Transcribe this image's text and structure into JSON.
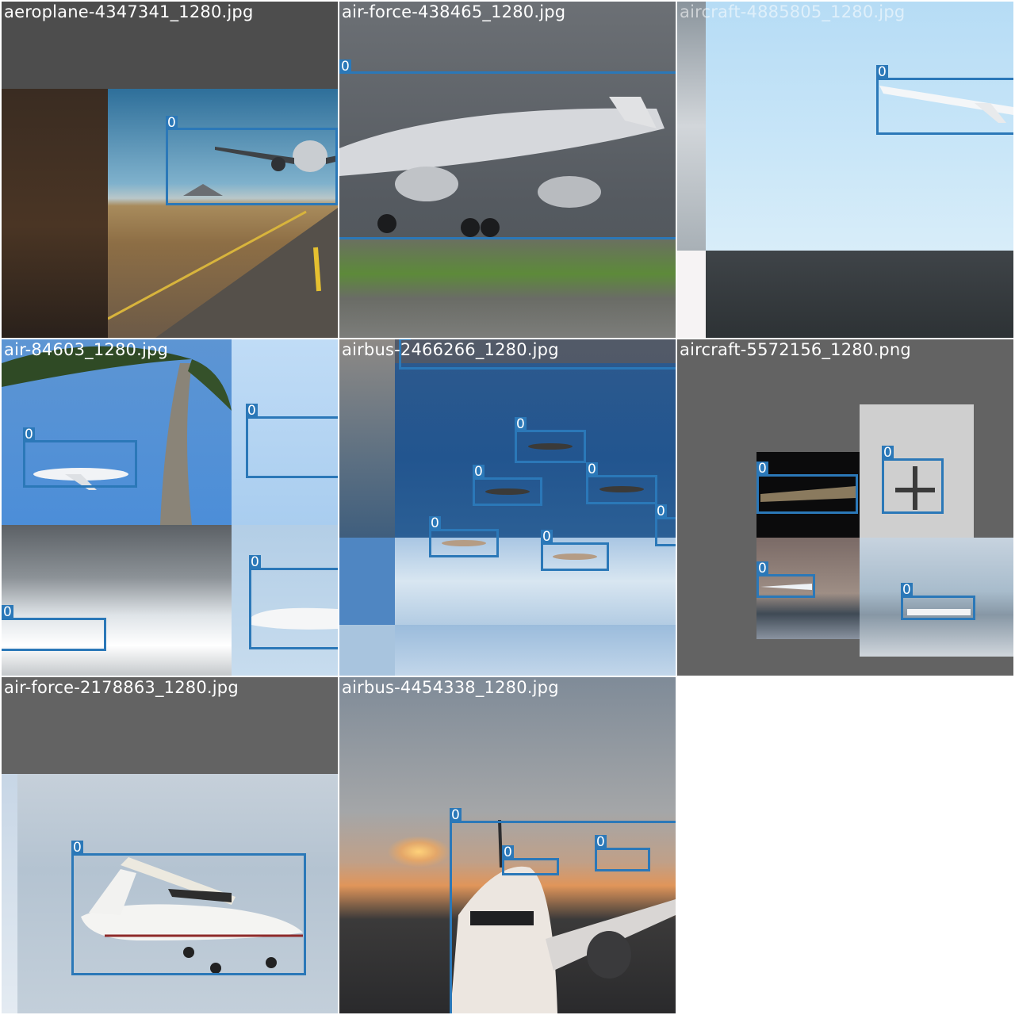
{
  "grid": {
    "tiles": [
      {
        "filename": "aeroplane-4347341_1280.jpg",
        "detections": [
          {
            "class_label": "0"
          }
        ]
      },
      {
        "filename": "air-force-438465_1280.jpg",
        "detections": [
          {
            "class_label": "0"
          }
        ]
      },
      {
        "filename": "aircraft-4885805_1280.jpg",
        "detections": [
          {
            "class_label": "0"
          }
        ]
      },
      {
        "filename": "air-84603_1280.jpg",
        "detections": [
          {
            "class_label": "0"
          },
          {
            "class_label": "0"
          },
          {
            "class_label": "0"
          },
          {
            "class_label": "0"
          }
        ]
      },
      {
        "filename": "airbus-2466266_1280.jpg",
        "detections": [
          {
            "class_label": "0"
          },
          {
            "class_label": "0"
          },
          {
            "class_label": "0"
          },
          {
            "class_label": "0"
          },
          {
            "class_label": "0"
          },
          {
            "class_label": "0"
          },
          {
            "class_label": "0"
          }
        ]
      },
      {
        "filename": "aircraft-5572156_1280.png",
        "detections": [
          {
            "class_label": "0"
          },
          {
            "class_label": "0"
          },
          {
            "class_label": "0"
          },
          {
            "class_label": "0"
          }
        ]
      },
      {
        "filename": "air-force-2178863_1280.jpg",
        "detections": [
          {
            "class_label": "0"
          }
        ]
      },
      {
        "filename": "airbus-4454338_1280.jpg",
        "detections": [
          {
            "class_label": "0"
          },
          {
            "class_label": "0"
          },
          {
            "class_label": "0"
          }
        ]
      }
    ]
  },
  "colors": {
    "box": "#2b78b8",
    "label_text": "#ffffff",
    "pad_gray": "#636363"
  }
}
